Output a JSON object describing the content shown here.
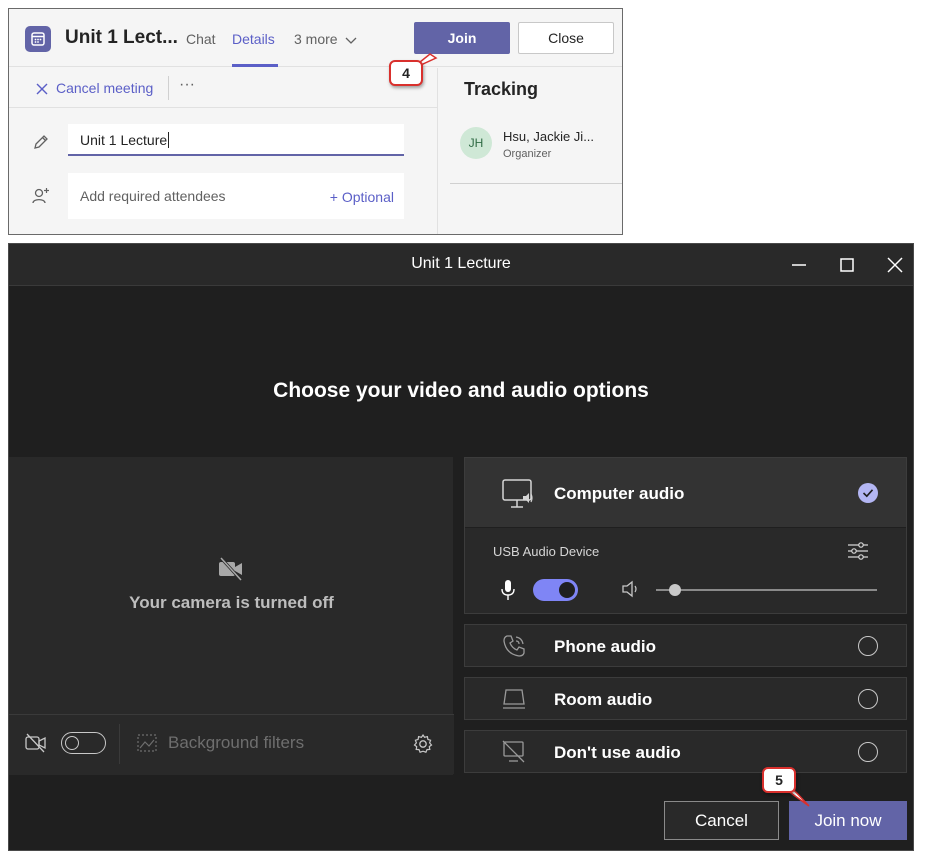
{
  "details": {
    "title": "Unit 1 Lect...",
    "tabs": [
      {
        "label": "Chat"
      },
      {
        "label": "Details"
      },
      {
        "label": "3 more"
      }
    ],
    "join_label": "Join",
    "close_label": "Close",
    "cancel_meeting_label": "Cancel meeting",
    "more_label": "···",
    "title_field_value": "Unit 1 Lecture",
    "attendees_placeholder": "Add required attendees",
    "optional_label": "+ Optional",
    "tracking_heading": "Tracking",
    "organizer": {
      "initials": "JH",
      "name": "Hsu, Jackie Ji...",
      "role": "Organizer"
    }
  },
  "callouts": {
    "step4": "4",
    "step5": "5"
  },
  "dialog": {
    "window_title": "Unit 1 Lecture",
    "heading": "Choose your video and audio options",
    "camera_off_text": "Your camera is turned off",
    "background_filters_label": "Background filters",
    "audio_options": [
      {
        "label": "Computer audio",
        "selected": true
      },
      {
        "label": "Phone audio",
        "selected": false
      },
      {
        "label": "Room audio",
        "selected": false
      },
      {
        "label": "Don't use audio",
        "selected": false
      }
    ],
    "device_label": "USB Audio Device",
    "mic_on": true,
    "camera_on": false,
    "cancel_label": "Cancel",
    "join_now_label": "Join now"
  },
  "colors": {
    "accent": "#6264a7",
    "callout_border": "#d9302d",
    "dialog_bg": "#1f1f1f"
  }
}
